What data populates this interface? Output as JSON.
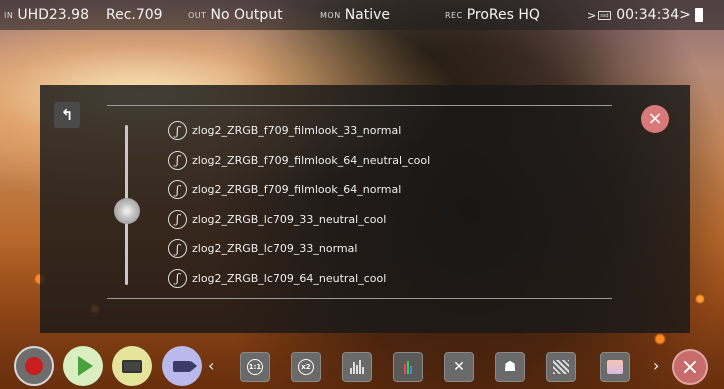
{
  "status_bar": {
    "input_tag": "IN",
    "input_format": "UHD23.98",
    "colour_space": "Rec.709",
    "output_tag": "OUT",
    "output_value": "No Output",
    "monitor_tag": "MON",
    "monitor_value": "Native",
    "rec_tag": "REC",
    "codec": "ProRes HQ",
    "remaining_prefix": ">",
    "remaining_time": "00:34:34>"
  },
  "lut_browser": {
    "files": [
      "zlog2_ZRGB_f709_filmlook_33_normal",
      "zlog2_ZRGB_f709_filmlook_64_neutral_cool",
      "zlog2_ZRGB_f709_filmlook_64_normal",
      "zlog2_ZRGB_lc709_33_neutral_cool",
      "zlog2_ZRGB_lc709_33_normal",
      "zlog2_ZRGB_lc709_64_neutral_cool"
    ],
    "back_icon": "↰",
    "close_icon": "×",
    "file_icon_glyph": "ʃ"
  },
  "toolbar": {
    "prev_chevron": "‹",
    "next_chevron": "›",
    "zoom_label": "1:1",
    "anamorphic_label": "x2",
    "close_glyph": "×"
  },
  "colors": {
    "record": "#c81e1e",
    "play": "#4aa23c",
    "close": "#d97a7a"
  }
}
